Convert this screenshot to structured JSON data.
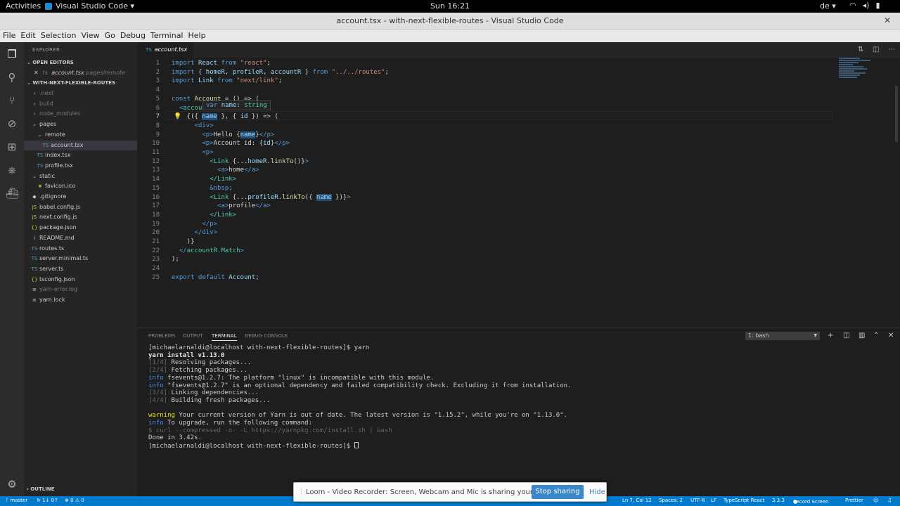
{
  "gnome": {
    "activities": "Activities",
    "app": "Visual Studio Code ▾",
    "clock": "Sun 16:21",
    "keyboard": "de ▾",
    "sys_icons": [
      "wifi-icon",
      "volume-icon",
      "battery-icon"
    ]
  },
  "window": {
    "title": "account.tsx - with-next-flexible-routes - Visual Studio Code",
    "close": "✕"
  },
  "menu": [
    "File",
    "Edit",
    "Selection",
    "View",
    "Go",
    "Debug",
    "Terminal",
    "Help"
  ],
  "activity_icons": [
    "files-icon",
    "search-icon",
    "source-control-icon",
    "debug-icon",
    "extensions-icon",
    "remote-icon",
    "docker-icon"
  ],
  "sidebar": {
    "title": "EXPLORER",
    "open_editors": "OPEN EDITORS",
    "open_editor": {
      "close": "✕",
      "type": "TS",
      "name": "account.tsx",
      "path": "pages/remote"
    },
    "project": "WITH-NEXT-FLEXIBLE-ROUTES",
    "items": [
      {
        "icon": "›",
        "label": ".next",
        "dim": true,
        "indent": 0
      },
      {
        "icon": "›",
        "label": "build",
        "dim": true,
        "indent": 0
      },
      {
        "icon": "›",
        "label": "node_modules",
        "dim": true,
        "indent": 0
      },
      {
        "icon": "⌄",
        "label": "pages",
        "dim": false,
        "indent": 0
      },
      {
        "icon": "⌄",
        "label": "remote",
        "dim": false,
        "indent": 1
      },
      {
        "icon": "TS",
        "label": "account.tsx",
        "dim": false,
        "indent": 2,
        "sel": true
      },
      {
        "icon": "TS",
        "label": "index.tsx",
        "dim": false,
        "indent": 1
      },
      {
        "icon": "TS",
        "label": "profile.tsx",
        "dim": false,
        "indent": 1
      },
      {
        "icon": "⌄",
        "label": "static",
        "dim": false,
        "indent": 0
      },
      {
        "icon": "★",
        "label": "favicon.ico",
        "dim": false,
        "indent": 1
      },
      {
        "icon": "◆",
        "label": ".gitignore",
        "dim": false,
        "indent": 0
      },
      {
        "icon": "JS",
        "label": "babel.config.js",
        "dim": false,
        "indent": 0
      },
      {
        "icon": "JS",
        "label": "next.config.js",
        "dim": false,
        "indent": 0
      },
      {
        "icon": "{}",
        "label": "package.json",
        "dim": false,
        "indent": 0
      },
      {
        "icon": "i",
        "label": "README.md",
        "dim": false,
        "indent": 0
      },
      {
        "icon": "TS",
        "label": "routes.ts",
        "dim": false,
        "indent": 0
      },
      {
        "icon": "TS",
        "label": "server.minimal.ts",
        "dim": false,
        "indent": 0
      },
      {
        "icon": "TS",
        "label": "server.ts",
        "dim": false,
        "indent": 0
      },
      {
        "icon": "{}",
        "label": "tsconfig.json",
        "dim": false,
        "indent": 0
      },
      {
        "icon": "≡",
        "label": "yarn-error.log",
        "dim": true,
        "indent": 0
      },
      {
        "icon": "≡",
        "label": "yarn.lock",
        "dim": false,
        "indent": 0
      }
    ],
    "outline": "OUTLINE"
  },
  "editor": {
    "tab": {
      "type": "TS",
      "name": "account.tsx"
    },
    "tab_actions": [
      "split-icon",
      "layout-icon",
      "more-icon"
    ],
    "hover": "var name: string",
    "lines": [
      "<span class='kw'>import</span> <span class='vr'>React</span> <span class='kw'>from</span> <span class='st'>\"react\"</span>;",
      "<span class='kw'>import</span> { <span class='vr'>homeR</span>, <span class='vr'>profileR</span>, <span class='vr'>accountR</span> } <span class='kw'>from</span> <span class='st'>\"../../routes\"</span>;",
      "<span class='kw'>import</span> <span class='vr'>Link</span> <span class='kw'>from</span> <span class='st'>\"next/link\"</span>;",
      "",
      "<span class='kw'>const</span> <span class='fn'>Account</span> = () =&gt; (",
      "  <span class='tg'>&lt;</span><span class='tn'>accou</span>",
      "    {({ <span class='vr hl'>name</span> }, { <span class='vr'>id</span> }) =&gt; (",
      "      <span class='tg'>&lt;div&gt;</span>",
      "        <span class='tg'>&lt;p&gt;</span>Hello {<span class='vr hl'>name</span>}<span class='tg'>&lt;/p&gt;</span>",
      "        <span class='tg'>&lt;p&gt;</span>Account id: {<span class='vr'>id</span>}<span class='tg'>&lt;/p&gt;</span>",
      "        <span class='tg'>&lt;p&gt;</span>",
      "          <span class='tn'>&lt;Link</span> {...<span class='vr'>homeR</span>.<span class='fn'>linkTo</span>()}<span class='tg'>&gt;</span>",
      "            <span class='tg'>&lt;a&gt;</span>home<span class='tg'>&lt;/a&gt;</span>",
      "          <span class='tn'>&lt;/Link&gt;</span>",
      "          <span class='tg'>&amp;nbsp;</span>",
      "          <span class='tn'>&lt;Link</span> {...<span class='vr'>profileR</span>.<span class='fn'>linkTo</span>({ <span class='vr hl'>name</span> })}<span class='tg'>&gt;</span>",
      "            <span class='tg'>&lt;a&gt;</span>profile<span class='tg'>&lt;/a&gt;</span>",
      "          <span class='tn'>&lt;/Link&gt;</span>",
      "        <span class='tg'>&lt;/p&gt;</span>",
      "      <span class='tg'>&lt;/div&gt;</span>",
      "    )}",
      "  <span class='tg'>&lt;/</span><span class='tn'>accountR.Match</span><span class='tg'>&gt;</span>",
      ");",
      "",
      "<span class='kw'>export default</span> <span class='vr'>Account</span>;"
    ],
    "current_line": 7
  },
  "panel": {
    "tabs": [
      "PROBLEMS",
      "OUTPUT",
      "TERMINAL",
      "DEBUG CONSOLE"
    ],
    "active_tab": "TERMINAL",
    "terminal_select": "1: bash",
    "icons": [
      "add-terminal-icon",
      "split-terminal-icon",
      "trash-icon",
      "maximize-icon",
      "close-icon"
    ],
    "lines": [
      "[michaelarnaldi@localhost with-next-flexible-routes]$ yarn",
      "<span class='b'>yarn install v1.13.0</span>",
      "<span class='gy'>[1/4]</span> Resolving packages...",
      "<span class='gy'>[2/4]</span> Fetching packages...",
      "<span class='bl'>info</span> fsevents@1.2.7: The platform \"linux\" is incompatible with this module.",
      "<span class='bl'>info</span> \"fsevents@1.2.7\" is an optional dependency and failed compatibility check. Excluding it from installation.",
      "<span class='gy'>[3/4]</span> Linking dependencies...",
      "<span class='gy'>[4/4]</span> Building fresh packages...",
      "",
      "<span class='yl'>warning</span> Your current version of Yarn is out of date. The latest version is \"1.15.2\", while you're on \"1.13.0\".",
      "<span class='bl'>info</span> To upgrade, run the following command:",
      "<span class='gy'>$ curl --compressed -o- -L https://yarnpkg.com/install.sh | bash</span>",
      "Done in 3.42s.",
      "[michaelarnaldi@localhost with-next-flexible-routes]$ <span class='cursor'></span>"
    ]
  },
  "status": {
    "branch": "ᚴ master",
    "sync": "↻ 1↓ 0↑",
    "problems": "⊗ 0 ⚠ 0",
    "position": "Ln 7, Col 12",
    "spaces": "Spaces: 2",
    "encoding": "UTF-8",
    "eol": "LF",
    "language": "TypeScript React",
    "ts_version": "3.3.3",
    "record": "Record Screen",
    "prettier": "Prettier",
    "smiley": "☺",
    "bell": "🔔"
  },
  "loom": {
    "message": "Loom - Video Recorder: Screen, Webcam and Mic is sharing your screen.",
    "stop": "Stop sharing",
    "hide": "Hide"
  }
}
